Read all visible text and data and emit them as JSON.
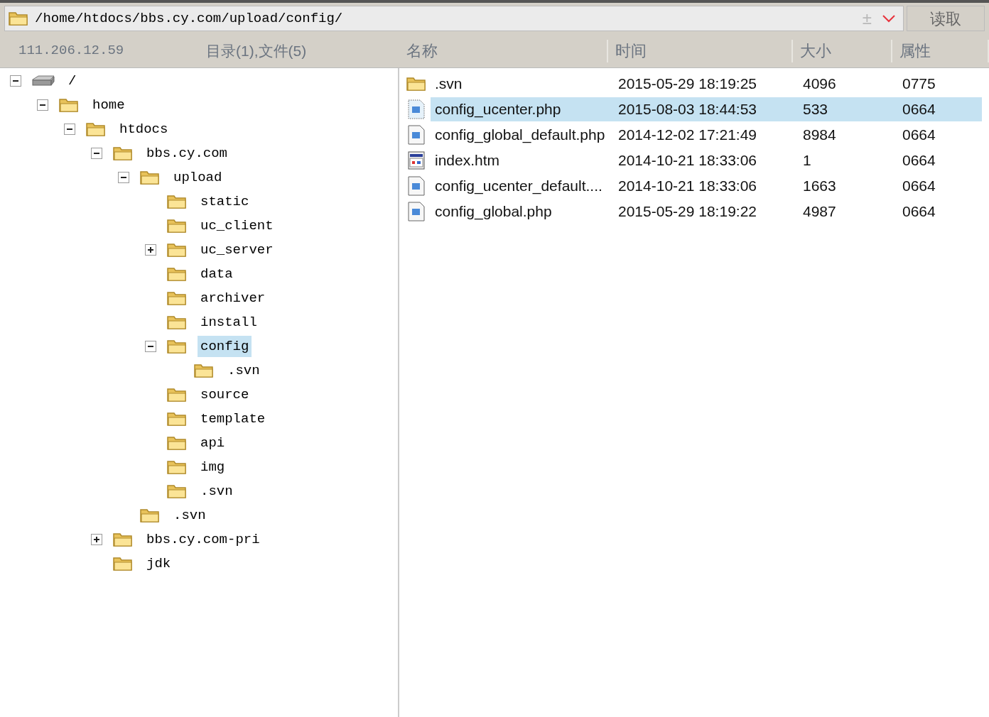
{
  "address_bar": {
    "path": "/home/htdocs/bbs.cy.com/upload/config/",
    "add_symbol": "±",
    "read_button": "读取"
  },
  "info_bar": {
    "host": "111.206.12.59",
    "summary": "目录(1),文件(5)"
  },
  "tree": [
    {
      "label": "/",
      "kind": "drive",
      "expanded": true,
      "selected": false,
      "children": [
        {
          "label": "home",
          "kind": "folder",
          "expanded": true,
          "selected": false,
          "children": [
            {
              "label": "htdocs",
              "kind": "folder",
              "expanded": true,
              "selected": false,
              "children": [
                {
                  "label": "bbs.cy.com",
                  "kind": "folder",
                  "expanded": true,
                  "selected": false,
                  "children": [
                    {
                      "label": "upload",
                      "kind": "folder",
                      "expanded": true,
                      "selected": false,
                      "children": [
                        {
                          "label": "static",
                          "kind": "folder",
                          "selected": false
                        },
                        {
                          "label": "uc_client",
                          "kind": "folder",
                          "selected": false
                        },
                        {
                          "label": "uc_server",
                          "kind": "folder",
                          "expanded": false,
                          "selected": false
                        },
                        {
                          "label": "data",
                          "kind": "folder",
                          "selected": false
                        },
                        {
                          "label": "archiver",
                          "kind": "folder",
                          "selected": false
                        },
                        {
                          "label": "install",
                          "kind": "folder",
                          "selected": false
                        },
                        {
                          "label": "config",
                          "kind": "folder",
                          "expanded": true,
                          "selected": true,
                          "children": [
                            {
                              "label": ".svn",
                              "kind": "folder",
                              "selected": false
                            }
                          ]
                        },
                        {
                          "label": "source",
                          "kind": "folder",
                          "selected": false
                        },
                        {
                          "label": "template",
                          "kind": "folder",
                          "selected": false
                        },
                        {
                          "label": "api",
                          "kind": "folder",
                          "selected": false
                        },
                        {
                          "label": "img",
                          "kind": "folder",
                          "selected": false
                        },
                        {
                          "label": ".svn",
                          "kind": "folder",
                          "selected": false
                        }
                      ]
                    },
                    {
                      "label": ".svn",
                      "kind": "folder",
                      "selected": false
                    }
                  ]
                },
                {
                  "label": "bbs.cy.com-pri",
                  "kind": "folder",
                  "expanded": false,
                  "selected": false
                },
                {
                  "label": "jdk",
                  "kind": "folder",
                  "selected": false
                }
              ]
            }
          ]
        }
      ]
    }
  ],
  "table": {
    "columns": [
      "名称",
      "时间",
      "大小",
      "属性"
    ],
    "rows": [
      {
        "kind": "folder",
        "name": ".svn",
        "time": "2015-05-29 18:19:25",
        "size": "4096",
        "mode": "0775",
        "selected": false
      },
      {
        "kind": "php",
        "name": "config_ucenter.php",
        "time": "2015-08-03 18:44:53",
        "size": "533",
        "mode": "0664",
        "selected": true
      },
      {
        "kind": "php",
        "name": "config_global_default.php",
        "time": "2014-12-02 17:21:49",
        "size": "8984",
        "mode": "0664",
        "selected": false
      },
      {
        "kind": "htm",
        "name": "index.htm",
        "time": "2014-10-21 18:33:06",
        "size": "1",
        "mode": "0664",
        "selected": false
      },
      {
        "kind": "php",
        "name": "config_ucenter_default....",
        "time": "2014-10-21 18:33:06",
        "size": "1663",
        "mode": "0664",
        "selected": false
      },
      {
        "kind": "php",
        "name": "config_global.php",
        "time": "2015-05-29 18:19:22",
        "size": "4987",
        "mode": "0664",
        "selected": false
      }
    ]
  }
}
